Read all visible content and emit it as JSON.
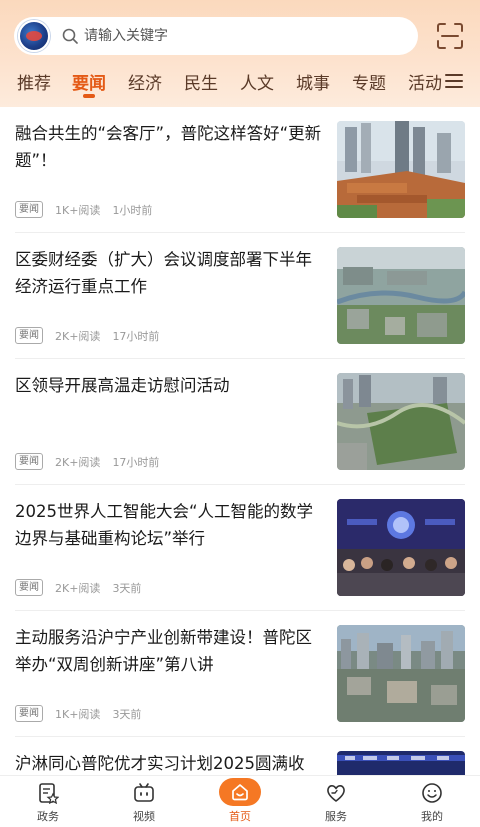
{
  "search": {
    "placeholder": "请输入关键字"
  },
  "tabs": [
    {
      "label": "推荐"
    },
    {
      "label": "要闻"
    },
    {
      "label": "经济"
    },
    {
      "label": "民生"
    },
    {
      "label": "人文"
    },
    {
      "label": "城事"
    },
    {
      "label": "专题"
    },
    {
      "label": "活动"
    }
  ],
  "active_tab": "要闻",
  "feed": [
    {
      "title": "融合共生的“会客厅”，普陀这样答好“更新题”！",
      "badge": "要闻",
      "reads": "1K+阅读",
      "time": "1小时前"
    },
    {
      "title": "区委财经委（扩大）会议调度部署下半年经济运行重点工作",
      "badge": "要闻",
      "reads": "2K+阅读",
      "time": "17小时前"
    },
    {
      "title": "区领导开展高温走访慰问活动",
      "badge": "要闻",
      "reads": "2K+阅读",
      "time": "17小时前"
    },
    {
      "title": "2025世界人工智能大会“人工智能的数学边界与基础重构论坛”举行",
      "badge": "要闻",
      "reads": "2K+阅读",
      "time": "3天前"
    },
    {
      "title": "主动服务沿沪宁产业创新带建设！普陀区举办“双周创新讲座”第八讲",
      "badge": "要闻",
      "reads": "1K+阅读",
      "time": "3天前"
    },
    {
      "title": "沪淋同心普陀优才实习计划2025圆满收",
      "badge": "",
      "reads": "",
      "time": ""
    }
  ],
  "bottom_nav": [
    {
      "label": "政务",
      "icon": "gov-icon"
    },
    {
      "label": "视频",
      "icon": "video-icon"
    },
    {
      "label": "首页",
      "icon": "home-icon"
    },
    {
      "label": "服务",
      "icon": "service-icon"
    },
    {
      "label": "我的",
      "icon": "profile-icon"
    }
  ],
  "colors": {
    "accent": "#e45a16",
    "header_bg": "#fbd9bd",
    "home_bubble": "#f57824"
  }
}
